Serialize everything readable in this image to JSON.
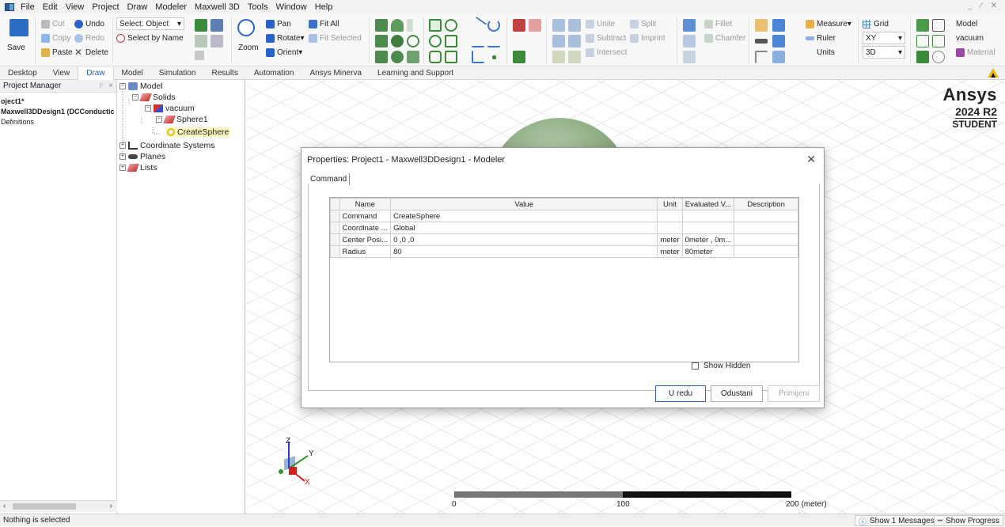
{
  "menu": [
    "File",
    "Edit",
    "View",
    "Project",
    "Draw",
    "Modeler",
    "Maxwell 3D",
    "Tools",
    "Window",
    "Help"
  ],
  "ribbon": {
    "save": "Save",
    "cut": "Cut",
    "undo": "Undo",
    "copy": "Copy",
    "redo": "Redo",
    "paste": "Paste",
    "delete": "Delete",
    "select_mode": "Select: Object",
    "select_by_name": "Select by Name",
    "zoom": "Zoom",
    "pan": "Pan",
    "rotate": "Rotate",
    "orient": "Orient",
    "fit_all": "Fit All",
    "fit_selected": "Fit Selected",
    "unite": "Unite",
    "split": "Split",
    "subtract": "Subtract",
    "imprint": "Imprint",
    "intersect": "Intersect",
    "fillet": "Fillet",
    "chamfer": "Chamfer",
    "measure": "Measure",
    "ruler": "Ruler",
    "units": "Units",
    "grid": "Grid",
    "plane": "XY",
    "dim": "3D",
    "model_label": "Model",
    "material_value": "vacuum",
    "material": "Material"
  },
  "tabs": [
    "Desktop",
    "View",
    "Draw",
    "Model",
    "Simulation",
    "Results",
    "Automation",
    "Ansys Minerva",
    "Learning and Support"
  ],
  "active_tab": "Draw",
  "project_manager": {
    "title": "Project Manager",
    "pin": "♇",
    "close": "×",
    "project": "oject1*",
    "design": "Maxwell3DDesign1 (DCConductic",
    "definitions": "Definitions"
  },
  "tree": {
    "model": "Model",
    "solids": "Solids",
    "vacuum": "vacuum",
    "sphere1": "Sphere1",
    "create_sphere": "CreateSphere",
    "coordinate_systems": "Coordinate Systems",
    "planes": "Planes",
    "lists": "Lists"
  },
  "brand": {
    "name": "Ansys",
    "version": "2024 R2",
    "edition": "STUDENT"
  },
  "scale": {
    "t0": "0",
    "t1": "100",
    "t2": "200 (meter)"
  },
  "dialog": {
    "title": "Properties: Project1 - Maxwell3DDesign1 - Modeler",
    "close": "✕",
    "tab": "Command",
    "columns": [
      "Name",
      "Value",
      "Unit",
      "Evaluated V...",
      "Description"
    ],
    "rows": [
      {
        "name": "Command",
        "value": "CreateSphere",
        "unit": "",
        "evaluated": "",
        "description": ""
      },
      {
        "name": "Coordinate ...",
        "value": "Global",
        "unit": "",
        "evaluated": "",
        "description": ""
      },
      {
        "name": "Center Posi...",
        "value": "0 ,0 ,0",
        "unit": "meter",
        "evaluated": "0meter , 0m...",
        "description": ""
      },
      {
        "name": "Radius",
        "value": "80",
        "unit": "meter",
        "evaluated": "80meter",
        "description": ""
      }
    ],
    "show_hidden": "Show Hidden",
    "ok": "U redu",
    "cancel": "Odustani",
    "apply": "Primijeni"
  },
  "axes": {
    "z": "Z",
    "y": "Y",
    "x": "X"
  },
  "status": {
    "text": "Nothing is selected",
    "messages": "Show 1 Messages",
    "progress": "Show Progress"
  },
  "colors": {
    "accent": "#2a62c7",
    "sphere": "#7e9f72"
  }
}
